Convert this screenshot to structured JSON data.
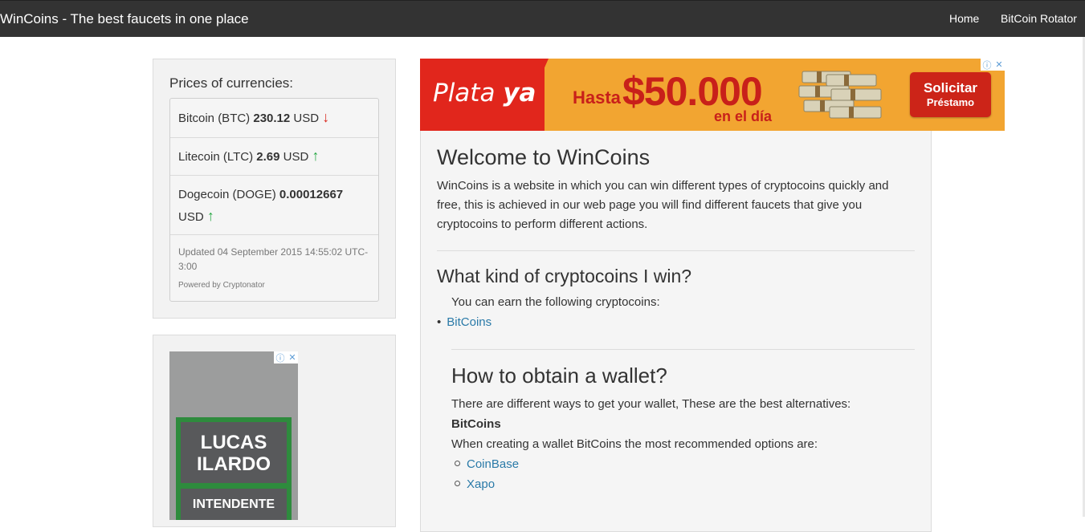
{
  "navbar": {
    "brand": "WinCoins - The best faucets in one place",
    "links": [
      "Home",
      "BitCoin Rotator"
    ]
  },
  "prices": {
    "title": "Prices of currencies:",
    "items": [
      {
        "name": "Bitcoin (BTC)",
        "value": "230.12",
        "unit": "USD",
        "arrow": "↓",
        "trend": "down"
      },
      {
        "name": "Litecoin (LTC)",
        "value": "2.69",
        "unit": "USD",
        "arrow": "↑",
        "trend": "up"
      },
      {
        "name": "Dogecoin (DOGE)",
        "value": "0.00012667",
        "unit": "USD",
        "arrow": "↑",
        "trend": "up"
      }
    ],
    "updated": "Updated 04 September 2015 14:55:02 UTC-3:00",
    "powered": "Powered by Cryptonator"
  },
  "ad_banner": {
    "brand_plain": "Plata ",
    "brand_bold": "ya",
    "hasta": "Hasta",
    "amount": "$50.000",
    "period": "en el día",
    "cta_line1": "Solicitar",
    "cta_line2": "Préstamo"
  },
  "ad_small": {
    "line1": "LUCAS",
    "line2": "ILARDO",
    "line3": "INTENDENTE"
  },
  "adchoices": {
    "info": "ⓘ",
    "close": "✕"
  },
  "main": {
    "welcome_title": "Welcome to WinCoins",
    "welcome_text": "WinCoins is a website in which you can win different types of cryptocoins quickly and free, this is achieved in our web page you will find different faucets that give you cryptocoins to perform different actions.",
    "kind_title": "What kind of cryptocoins I win?",
    "earn_text": "You can earn the following cryptocoins:",
    "coins": [
      "BitCoins"
    ],
    "wallet_title": "How to obtain a wallet?",
    "wallet_text": "There are different ways to get your wallet, These are the best alternatives:",
    "wallet_coin": "BitCoins",
    "wallet_reco": "When creating a wallet BitCoins the most recommended options are:",
    "wallet_options": [
      "CoinBase",
      "Xapo"
    ]
  },
  "colors": {
    "navbar": "#333333",
    "link": "#2a7aa8",
    "down": "#d9261c",
    "up": "#27a844",
    "ad_red": "#e1261c",
    "ad_orange": "#f2a531"
  }
}
